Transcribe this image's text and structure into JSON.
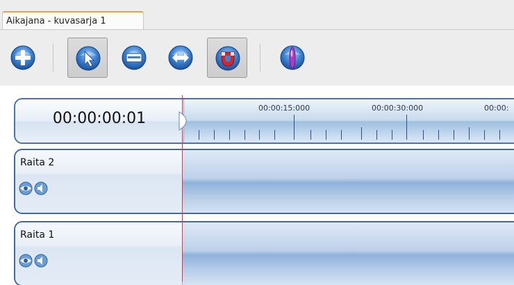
{
  "tab": {
    "label": "Aikajana - kuvasarja 1"
  },
  "toolbar": {
    "buttons": [
      {
        "name": "add-track-button",
        "icon": "plus-icon",
        "active": false
      },
      {
        "name": "select-tool-button",
        "icon": "pointer-icon",
        "active": true
      },
      {
        "name": "razor-tool-button",
        "icon": "blade-icon",
        "active": false
      },
      {
        "name": "resize-tool-button",
        "icon": "arrows-icon",
        "active": false
      },
      {
        "name": "magnet-snap-button",
        "icon": "magnet-icon",
        "active": true
      },
      {
        "name": "marker-button",
        "icon": "marker-icon",
        "active": false
      }
    ]
  },
  "timeline": {
    "current_time": "00:00:00:01",
    "ruler_labels": [
      "00:00:15:000",
      "00:00:30:000",
      "00:00:"
    ],
    "tracks": [
      {
        "name": "Raita 2"
      },
      {
        "name": "Raita 1"
      }
    ]
  },
  "colors": {
    "accent_tab": "#f0a23a",
    "track_border": "#3f67ad",
    "playhead": "#d93a3a"
  }
}
